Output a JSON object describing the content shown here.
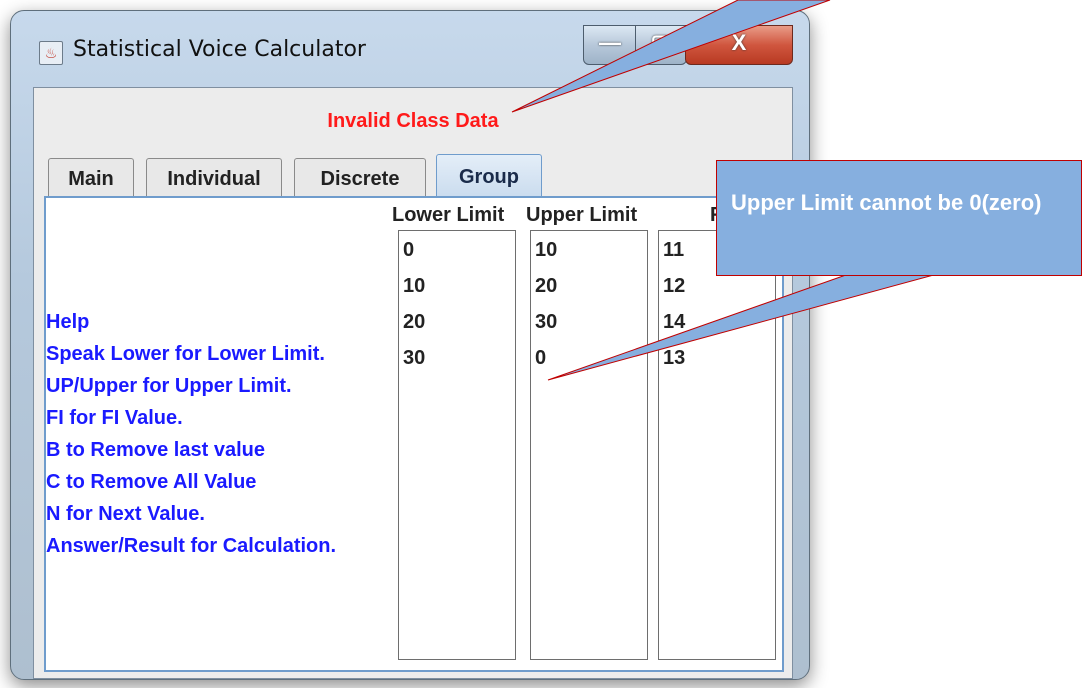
{
  "window": {
    "title": "Statistical Voice Calculator",
    "minimize_glyph": "—",
    "maximize_glyph": "▢",
    "close_glyph": "X",
    "icon": "java-app-icon"
  },
  "status_message": "Invalid Class Data",
  "tabs": [
    {
      "label": "Main"
    },
    {
      "label": "Individual"
    },
    {
      "label": "Discrete"
    },
    {
      "label": "Group",
      "selected": true
    }
  ],
  "columns": {
    "lower": {
      "header": "Lower Limit",
      "values": [
        "0",
        "10",
        "20",
        "30"
      ]
    },
    "upper": {
      "header": "Upper Limit",
      "values": [
        "10",
        "20",
        "30",
        "0"
      ]
    },
    "fi": {
      "header": "FI",
      "values": [
        "11",
        "12",
        "14",
        "13"
      ]
    }
  },
  "help": [
    "Help",
    "Speak Lower for Lower Limit.",
    "UP/Upper for Upper Limit.",
    "FI for FI Value.",
    "B to Remove last value",
    "C to Remove All Value",
    "N for Next Value.",
    "Answer/Result for Calculation."
  ],
  "callout": {
    "text": "Upper Limit cannot be 0(zero)"
  },
  "colors": {
    "status": "#ff1a1a",
    "help_text": "#1a1aff",
    "callout_fill": "#86afdf",
    "callout_border": "#c00000"
  }
}
